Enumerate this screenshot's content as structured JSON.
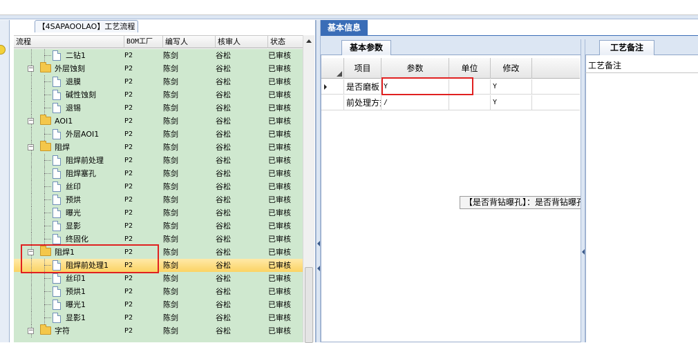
{
  "left_pane": {
    "tab_label": "【4SAPAOOLAO】工艺流程",
    "columns": {
      "flow": "流程",
      "bom": "BOM工厂",
      "author": "编写人",
      "reviewer": "核审人",
      "status": "状态"
    },
    "rows": [
      {
        "label": "二钻1",
        "kind": "doc",
        "level": 2,
        "bom": "P2",
        "author": "陈剑",
        "reviewer": "谷松",
        "status": "已审核"
      },
      {
        "label": "外层蚀刻",
        "kind": "folder",
        "level": 1,
        "bom": "P2",
        "author": "陈剑",
        "reviewer": "谷松",
        "status": "已审核"
      },
      {
        "label": "退膜",
        "kind": "doc",
        "level": 2,
        "bom": "P2",
        "author": "陈剑",
        "reviewer": "谷松",
        "status": "已审核"
      },
      {
        "label": "碱性蚀刻",
        "kind": "doc",
        "level": 2,
        "bom": "P2",
        "author": "陈剑",
        "reviewer": "谷松",
        "status": "已审核"
      },
      {
        "label": "退锡",
        "kind": "doc",
        "level": 2,
        "bom": "P2",
        "author": "陈剑",
        "reviewer": "谷松",
        "status": "已审核"
      },
      {
        "label": "AOI1",
        "kind": "folder",
        "level": 1,
        "bom": "P2",
        "author": "陈剑",
        "reviewer": "谷松",
        "status": "已审核"
      },
      {
        "label": "外层AOI1",
        "kind": "doc",
        "level": 2,
        "bom": "P2",
        "author": "陈剑",
        "reviewer": "谷松",
        "status": "已审核"
      },
      {
        "label": "阻焊",
        "kind": "folder",
        "level": 1,
        "bom": "P2",
        "author": "陈剑",
        "reviewer": "谷松",
        "status": "已审核"
      },
      {
        "label": "阻焊前处理",
        "kind": "doc",
        "level": 2,
        "bom": "P2",
        "author": "陈剑",
        "reviewer": "谷松",
        "status": "已审核"
      },
      {
        "label": "阻焊塞孔",
        "kind": "doc",
        "level": 2,
        "bom": "P2",
        "author": "陈剑",
        "reviewer": "谷松",
        "status": "已审核"
      },
      {
        "label": "丝印",
        "kind": "doc",
        "level": 2,
        "bom": "P2",
        "author": "陈剑",
        "reviewer": "谷松",
        "status": "已审核"
      },
      {
        "label": "预烘",
        "kind": "doc",
        "level": 2,
        "bom": "P2",
        "author": "陈剑",
        "reviewer": "谷松",
        "status": "已审核"
      },
      {
        "label": "曝光",
        "kind": "doc",
        "level": 2,
        "bom": "P2",
        "author": "陈剑",
        "reviewer": "谷松",
        "status": "已审核"
      },
      {
        "label": "显影",
        "kind": "doc",
        "level": 2,
        "bom": "P2",
        "author": "陈剑",
        "reviewer": "谷松",
        "status": "已审核"
      },
      {
        "label": "终固化",
        "kind": "doc",
        "level": 2,
        "bom": "P2",
        "author": "陈剑",
        "reviewer": "谷松",
        "status": "已审核"
      },
      {
        "label": "阻焊1",
        "kind": "folder",
        "level": 1,
        "bom": "P2",
        "author": "陈剑",
        "reviewer": "谷松",
        "status": "已审核"
      },
      {
        "label": "阻焊前处理1",
        "kind": "doc",
        "level": 2,
        "bom": "P2",
        "author": "陈剑",
        "reviewer": "谷松",
        "status": "已审核",
        "selected": true
      },
      {
        "label": "丝印1",
        "kind": "doc",
        "level": 2,
        "bom": "P2",
        "author": "陈剑",
        "reviewer": "谷松",
        "status": "已审核"
      },
      {
        "label": "预烘1",
        "kind": "doc",
        "level": 2,
        "bom": "P2",
        "author": "陈剑",
        "reviewer": "谷松",
        "status": "已审核"
      },
      {
        "label": "曝光1",
        "kind": "doc",
        "level": 2,
        "bom": "P2",
        "author": "陈剑",
        "reviewer": "谷松",
        "status": "已审核"
      },
      {
        "label": "显影1",
        "kind": "doc",
        "level": 2,
        "bom": "P2",
        "author": "陈剑",
        "reviewer": "谷松",
        "status": "已审核"
      },
      {
        "label": "字符",
        "kind": "folder",
        "level": 1,
        "bom": "P2",
        "author": "陈剑",
        "reviewer": "谷松",
        "status": "已审核"
      }
    ]
  },
  "right_pane": {
    "main_tab": "基本信息",
    "params_tab": "基本参数",
    "grid_headers": {
      "item": "项目",
      "param": "参数",
      "unit": "单位",
      "modify": "修改"
    },
    "grid_rows": [
      {
        "item": "是否磨板",
        "param": "Y",
        "unit": "",
        "modify": "Y",
        "current": true
      },
      {
        "item": "前处理方式",
        "param": "/",
        "unit": "",
        "modify": "Y",
        "current": false
      }
    ],
    "tooltip": "【是否背钻曝孔】：是否背钻曝孔",
    "notes_tab": "工艺备注",
    "notes_header": "工艺备注"
  }
}
